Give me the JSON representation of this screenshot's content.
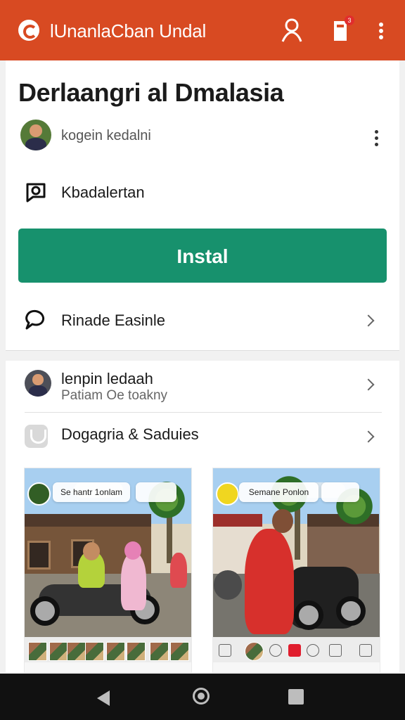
{
  "header": {
    "title": "lUnanlaCban Undal",
    "badge_count": "3",
    "background_color": "#d84a22",
    "icons": [
      "app-logo",
      "profile-icon",
      "notification-icon",
      "more-vertical-icon"
    ]
  },
  "article": {
    "headline": "Derlaangri al Dmalasia",
    "author": "kogein kedalni",
    "comment_label": "Kbadalertan",
    "install_label": "Instal",
    "related_label": "Rinade Easinle"
  },
  "suggestion_list": {
    "person_title": "lenpin ledaah",
    "person_subtitle": "Patiam Oe toakny",
    "guides_label": "Dogagria & Saduies"
  },
  "photo_cards": [
    {
      "tag": "Se hantr 1onlam",
      "badge_text": ""
    },
    {
      "tag": "Semane Ponlon",
      "badge_text": ""
    }
  ],
  "colors": {
    "install": "#17916d",
    "accent": "#d84a22",
    "navigation": "#111111"
  }
}
